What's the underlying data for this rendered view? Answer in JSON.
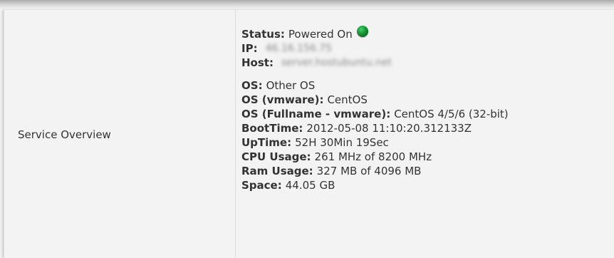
{
  "table": {
    "row_label": "Service Overview",
    "status": {
      "key": "Status",
      "value": "Powered On",
      "indicator_color": "#1b9a39"
    },
    "ip": {
      "key": "IP",
      "value": "46.16.156.75"
    },
    "host": {
      "key": "Host",
      "value": "server.hostubuntu.net"
    },
    "os": {
      "key": "OS",
      "value": "Other OS"
    },
    "os_vmware": {
      "key": "OS (vmware)",
      "value": "CentOS"
    },
    "os_fullname": {
      "key": "OS (Fullname - vmware)",
      "value": "CentOS 4/5/6 (32-bit)"
    },
    "boottime": {
      "key": "BootTime",
      "value": "2012-05-08 11:10:20.312133Z"
    },
    "uptime": {
      "key": "UpTime",
      "value": "52H 30Min 19Sec"
    },
    "cpu": {
      "key": "CPU Usage",
      "value": "261 MHz of 8200 MHz"
    },
    "ram": {
      "key": "Ram Usage",
      "value": "327 MB of 4096 MB"
    },
    "space": {
      "key": "Space",
      "value": "44.05 GB"
    }
  }
}
